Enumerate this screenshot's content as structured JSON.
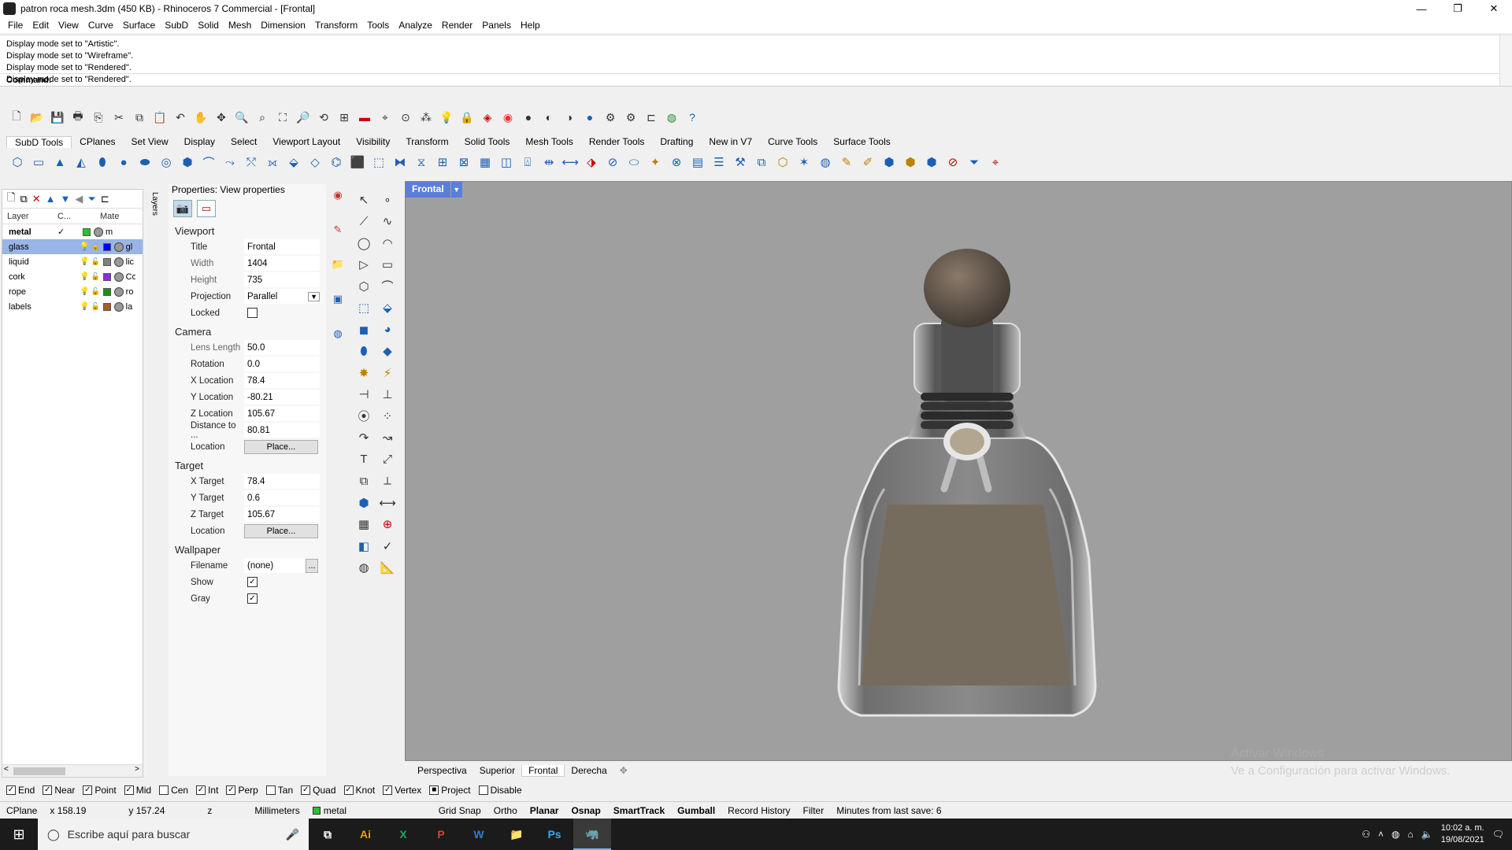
{
  "window": {
    "title": "patron roca mesh.3dm (450 KB) - Rhinoceros 7 Commercial - [Frontal]",
    "min": "—",
    "max": "❐",
    "close": "✕"
  },
  "menu": [
    "File",
    "Edit",
    "View",
    "Curve",
    "Surface",
    "SubD",
    "Solid",
    "Mesh",
    "Dimension",
    "Transform",
    "Tools",
    "Analyze",
    "Render",
    "Panels",
    "Help"
  ],
  "history": [
    "Display mode set to \"Artistic\".",
    "Display mode set to \"Wireframe\".",
    "Display mode set to \"Rendered\".",
    "Display mode set to \"Rendered\"."
  ],
  "command_label": "Command:",
  "toolbar_tabs": [
    "SubD Tools",
    "CPlanes",
    "Set View",
    "Display",
    "Select",
    "Viewport Layout",
    "Visibility",
    "Transform",
    "Solid Tools",
    "Mesh Tools",
    "Render Tools",
    "Drafting",
    "New in V7",
    "Curve Tools",
    "Surface Tools"
  ],
  "layers": {
    "headers": {
      "layer": "Layer",
      "current": "C...",
      "material": "Mate"
    },
    "tab_label": "Layers",
    "rows": [
      {
        "name": "metal",
        "current": "✓",
        "color": "#2fbf2f",
        "material": "m",
        "selected": false,
        "bold": true
      },
      {
        "name": "glass",
        "current": "",
        "color": "#0000ff",
        "material": "gl",
        "selected": true,
        "bold": false
      },
      {
        "name": "liquid",
        "current": "",
        "color": "#808080",
        "material": "lic",
        "selected": false,
        "bold": false
      },
      {
        "name": "cork",
        "current": "",
        "color": "#8a2be2",
        "material": "Co",
        "selected": false,
        "bold": false
      },
      {
        "name": "rope",
        "current": "",
        "color": "#1a8f1a",
        "material": "ro",
        "selected": false,
        "bold": false
      },
      {
        "name": "labels",
        "current": "",
        "color": "#a0602a",
        "material": "la",
        "selected": false,
        "bold": false
      }
    ]
  },
  "properties": {
    "title": "Properties: View properties",
    "viewport": {
      "heading": "Viewport",
      "title_label": "Title",
      "title_value": "Frontal",
      "width_label": "Width",
      "width_value": "1404",
      "height_label": "Height",
      "height_value": "735",
      "projection_label": "Projection",
      "projection_value": "Parallel",
      "locked_label": "Locked"
    },
    "camera": {
      "heading": "Camera",
      "lens_label": "Lens Length",
      "lens_value": "50.0",
      "rotation_label": "Rotation",
      "rotation_value": "0.0",
      "x_label": "X Location",
      "x_value": "78.4",
      "y_label": "Y Location",
      "y_value": "-80.21",
      "z_label": "Z Location",
      "z_value": "105.67",
      "dist_label": "Distance to ...",
      "dist_value": "80.81",
      "loc_label": "Location",
      "loc_button": "Place..."
    },
    "target": {
      "heading": "Target",
      "x_label": "X Target",
      "x_value": "78.4",
      "y_label": "Y Target",
      "y_value": "0.6",
      "z_label": "Z Target",
      "z_value": "105.67",
      "loc_label": "Location",
      "loc_button": "Place..."
    },
    "wallpaper": {
      "heading": "Wallpaper",
      "filename_label": "Filename",
      "filename_value": "(none)",
      "browse": "...",
      "show_label": "Show",
      "show_checked": "✓",
      "gray_label": "Gray",
      "gray_checked": "✓"
    }
  },
  "viewport": {
    "name": "Frontal",
    "dropdown": "▼",
    "watermark_title": "Activar Windows",
    "watermark_text": "Ve a Configuración para activar Windows."
  },
  "viewport_tabs": [
    "Perspectiva",
    "Superior",
    "Frontal",
    "Derecha",
    "✥"
  ],
  "osnaps": [
    {
      "label": "End",
      "on": "✓"
    },
    {
      "label": "Near",
      "on": "✓"
    },
    {
      "label": "Point",
      "on": "✓"
    },
    {
      "label": "Mid",
      "on": "✓"
    },
    {
      "label": "Cen",
      "on": ""
    },
    {
      "label": "Int",
      "on": "✓"
    },
    {
      "label": "Perp",
      "on": "✓"
    },
    {
      "label": "Tan",
      "on": ""
    },
    {
      "label": "Quad",
      "on": "✓"
    },
    {
      "label": "Knot",
      "on": "✓"
    },
    {
      "label": "Vertex",
      "on": "✓"
    },
    {
      "label": "Project",
      "on": "■"
    },
    {
      "label": "Disable",
      "on": ""
    }
  ],
  "status": {
    "cplane": "CPlane",
    "x": "x 158.19",
    "y": "y 157.24",
    "z": "z",
    "units": "Millimeters",
    "layer": "metal",
    "layer_color": "#2fbf2f",
    "grid_snap": "Grid Snap",
    "ortho": "Ortho",
    "planar": "Planar",
    "osnap": "Osnap",
    "smarttrack": "SmartTrack",
    "gumball": "Gumball",
    "record_history": "Record History",
    "filter": "Filter",
    "save_info": "Minutes from last save: 6"
  },
  "taskbar": {
    "search_placeholder": "Escribe aquí para buscar",
    "apps": [
      "⧉",
      "Ai",
      "X",
      "P",
      "W",
      "📁",
      "Ps",
      "🦏"
    ],
    "time": "10:02 a. m.",
    "date": "19/08/2021"
  }
}
